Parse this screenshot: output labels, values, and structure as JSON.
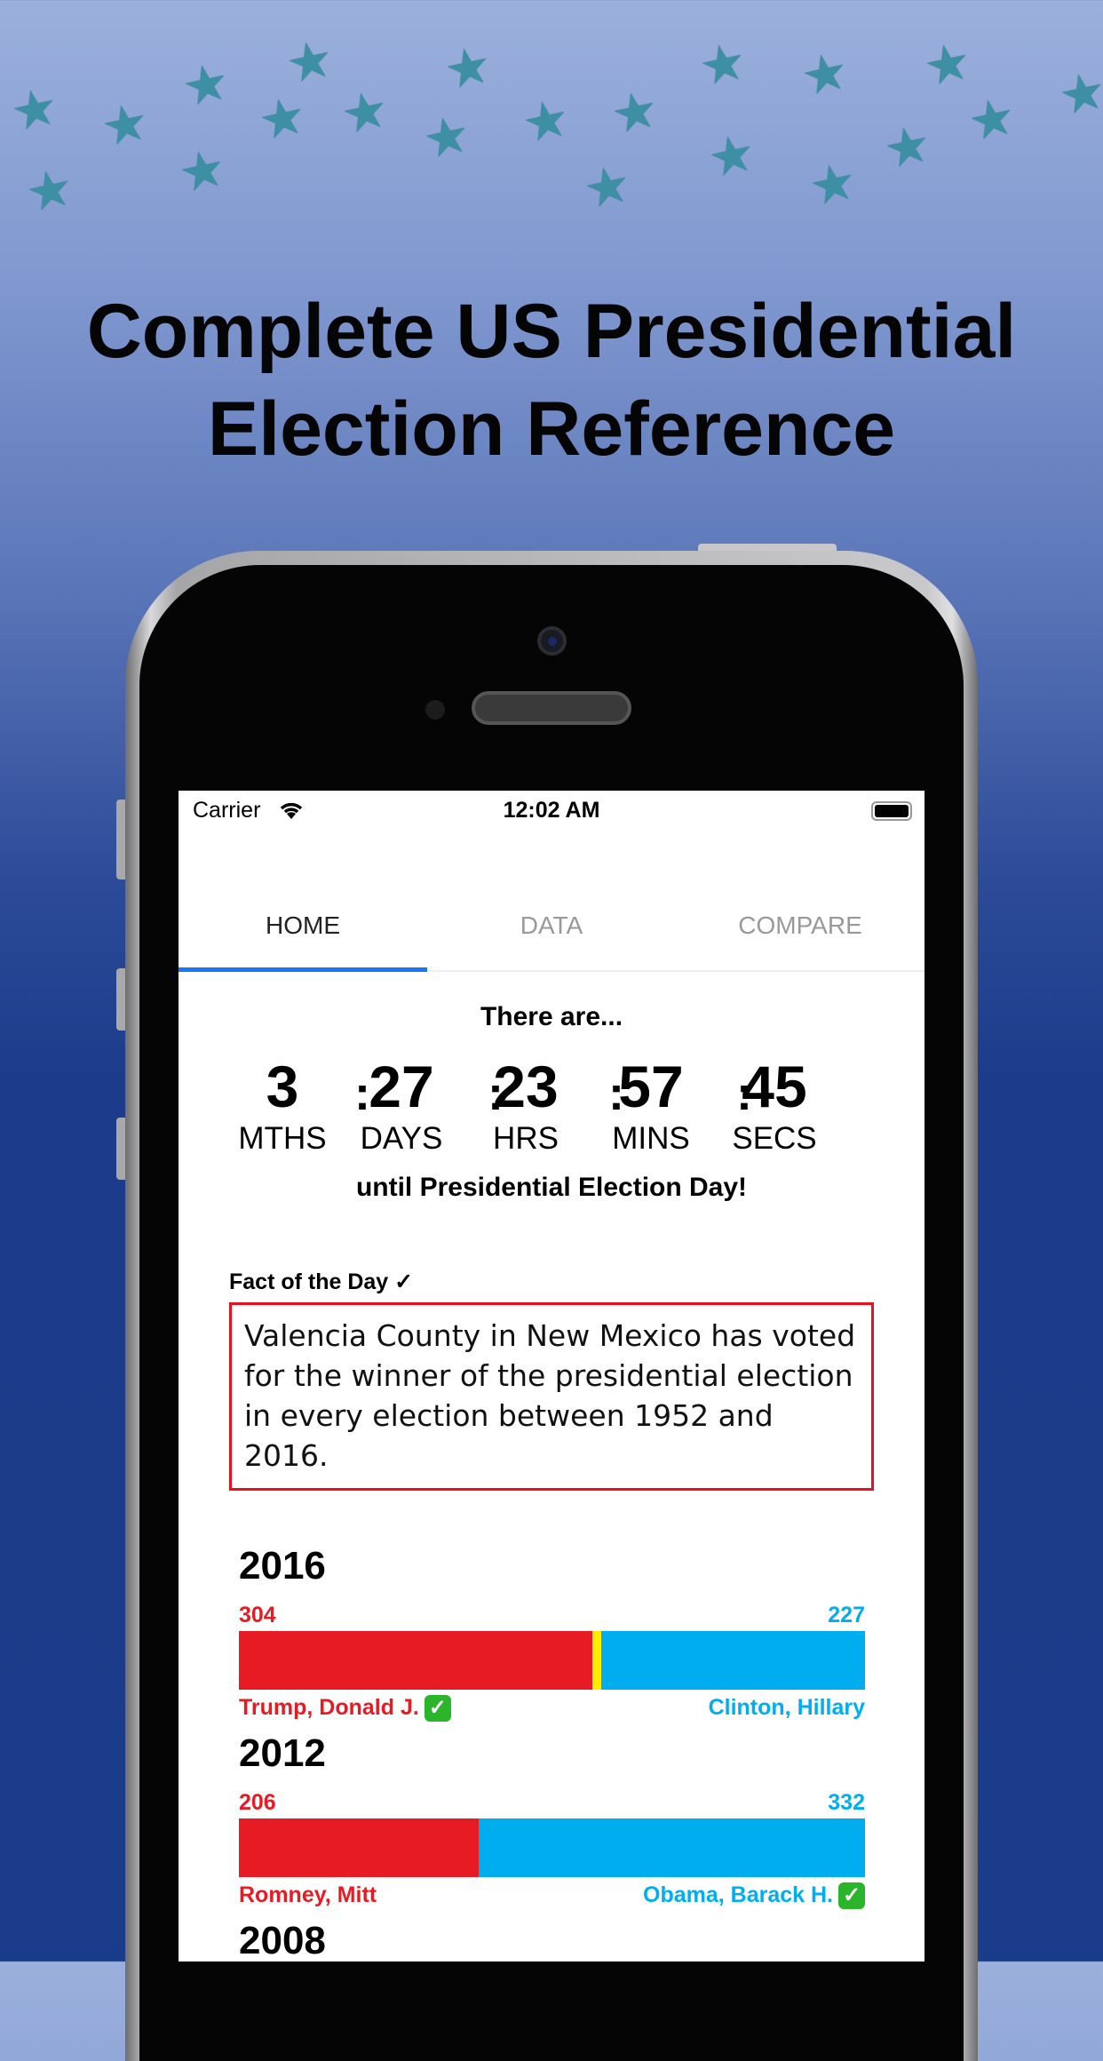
{
  "headline": [
    "Complete US Presidential",
    "Election Reference"
  ],
  "status_bar": {
    "carrier": "Carrier",
    "time": "12:02 AM"
  },
  "tabs": [
    {
      "label": "HOME",
      "active": true
    },
    {
      "label": "DATA"
    },
    {
      "label": "COMPARE"
    }
  ],
  "countdown": {
    "intro": "There are...",
    "outro": "until Presidential Election Day!",
    "units": [
      {
        "value": "3",
        "label": "MTHS"
      },
      {
        "value": "27",
        "label": "DAYS"
      },
      {
        "value": "23",
        "label": "HRS"
      },
      {
        "value": "57",
        "label": "MINS"
      },
      {
        "value": "45",
        "label": "SECS"
      }
    ],
    "separator": ":"
  },
  "fact": {
    "title": "Fact of the Day ✓",
    "text": "Valencia County in New Mexico has voted for the winner of the presidential election in every election between 1952 and 2016."
  },
  "elections": [
    {
      "year": "2016",
      "rep_ev": "304",
      "dem_ev": "227",
      "other_ev": 7,
      "total_ev": 538,
      "rep_name": "Trump, Donald J.",
      "dem_name": "Clinton, Hillary",
      "winner": "rep"
    },
    {
      "year": "2012",
      "rep_ev": "206",
      "dem_ev": "332",
      "other_ev": 0,
      "total_ev": 538,
      "rep_name": "Romney, Mitt",
      "dem_name": "Obama, Barack H.",
      "winner": "dem"
    },
    {
      "year": "2008"
    }
  ],
  "colors": {
    "rep": "#e61b23",
    "dem": "#00aeef",
    "other": "#ffee00",
    "tab_indicator": "#1a75f0",
    "fact_border": "#e8101f",
    "star": "#3d8fa3"
  },
  "icons": {
    "winner": "check-mark-icon",
    "star": "star-icon"
  }
}
